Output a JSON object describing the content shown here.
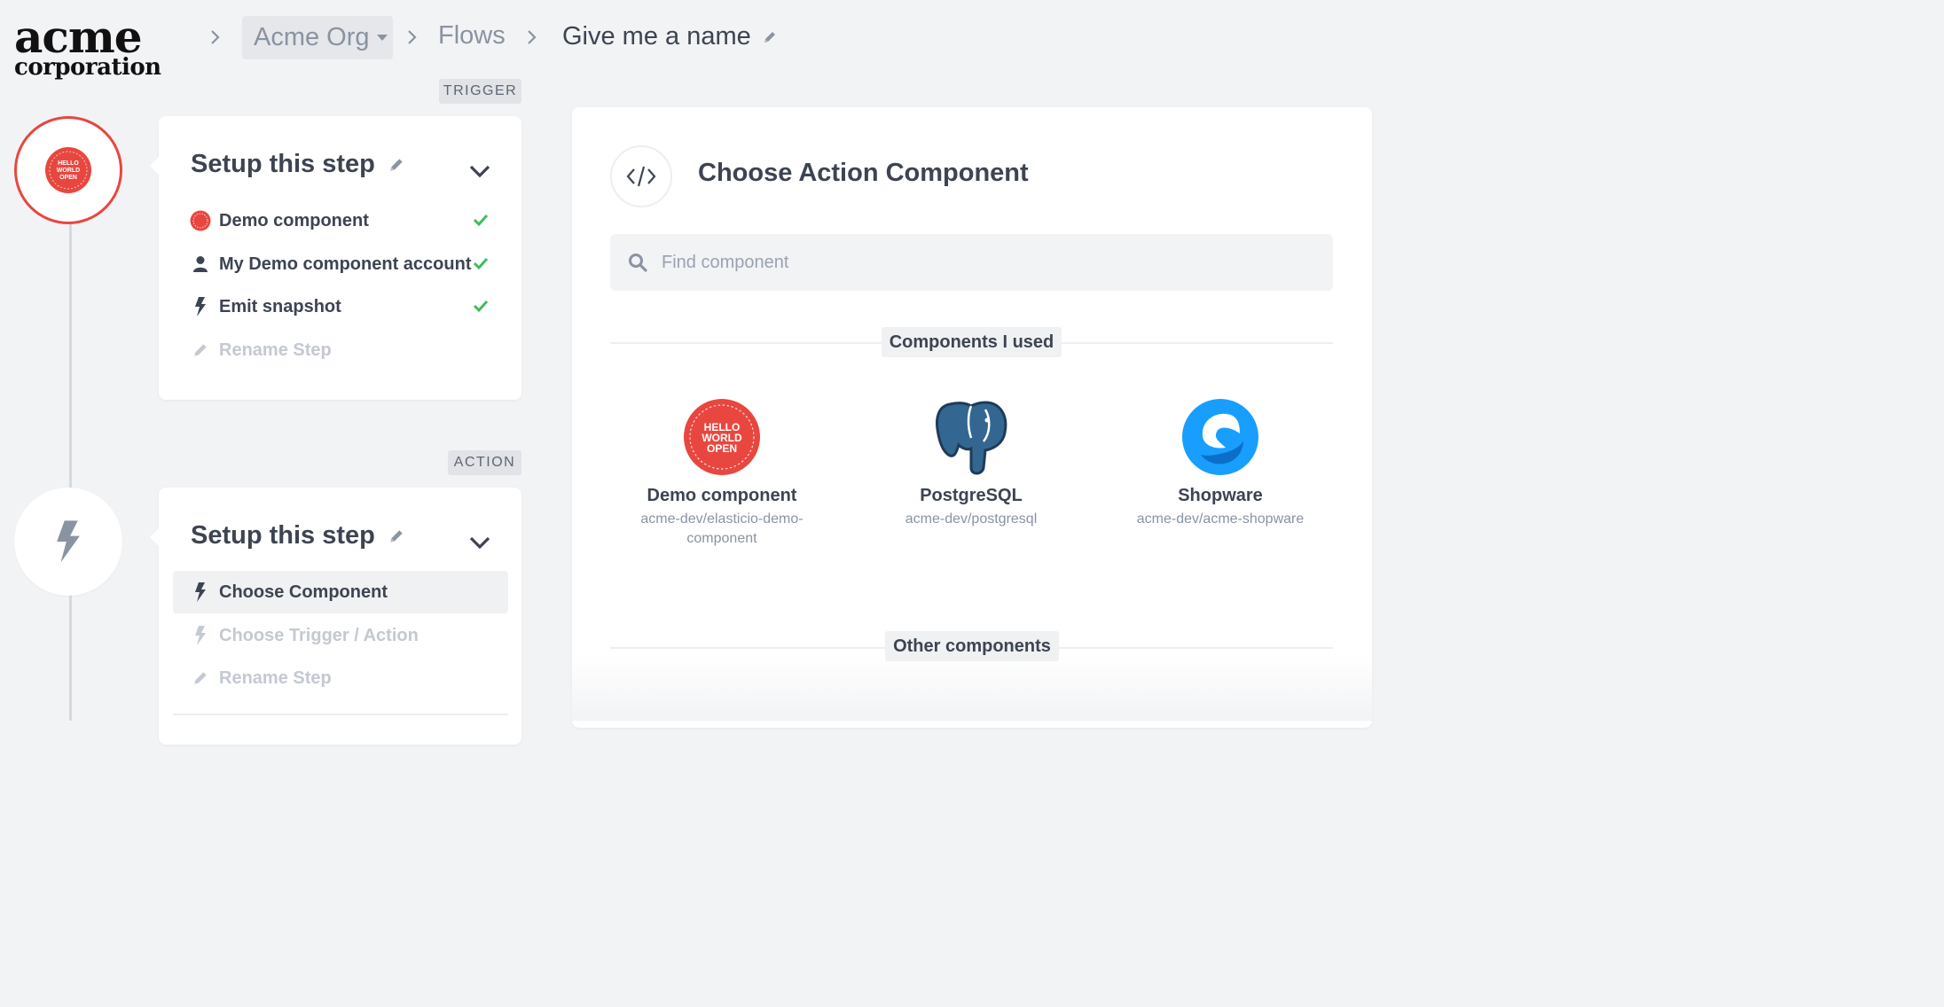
{
  "header": {
    "logo_line1": "acme",
    "logo_line2": "corporation",
    "org": "Acme Org",
    "flows": "Flows",
    "flow_name": "Give me a name"
  },
  "trigger": {
    "tag": "TRIGGER",
    "title": "Setup this step",
    "items": [
      {
        "label": "Demo component",
        "icon": "hello-world-logo-icon",
        "done": true
      },
      {
        "label": "My Demo component account",
        "icon": "user-icon",
        "done": true
      },
      {
        "label": "Emit snapshot",
        "icon": "bolt-icon",
        "done": true
      },
      {
        "label": "Rename Step",
        "icon": "pencil-icon",
        "done": false
      }
    ]
  },
  "action": {
    "tag": "ACTION",
    "title": "Setup this step",
    "items": [
      {
        "label": "Choose Component",
        "icon": "bolt-icon"
      },
      {
        "label": "Choose Trigger / Action",
        "icon": "bolt-icon"
      },
      {
        "label": "Rename Step",
        "icon": "pencil-icon"
      }
    ]
  },
  "main": {
    "title": "Choose Action Component",
    "search_placeholder": "Find component",
    "used_label": "Components I used",
    "other_label": "Other components",
    "components": [
      {
        "name": "Demo component",
        "slug": "acme-dev/elasticio-demo-component",
        "icon": "hello-world-logo-icon"
      },
      {
        "name": "PostgreSQL",
        "slug": "acme-dev/postgresql",
        "icon": "postgresql-elephant-icon"
      },
      {
        "name": "Shopware",
        "slug": "acme-dev/acme-shopware",
        "icon": "shopware-logo-icon"
      }
    ]
  },
  "logo_badge": {
    "line1": "HELLO",
    "line2": "WORLD",
    "line3": "OPEN"
  },
  "colors": {
    "accent_red": "#e8473f",
    "check_green": "#3dbd5d",
    "text_dark": "#3d4451",
    "text_muted": "#8a93a2",
    "postgres_blue": "#336791",
    "shopware_blue": "#189eff"
  }
}
